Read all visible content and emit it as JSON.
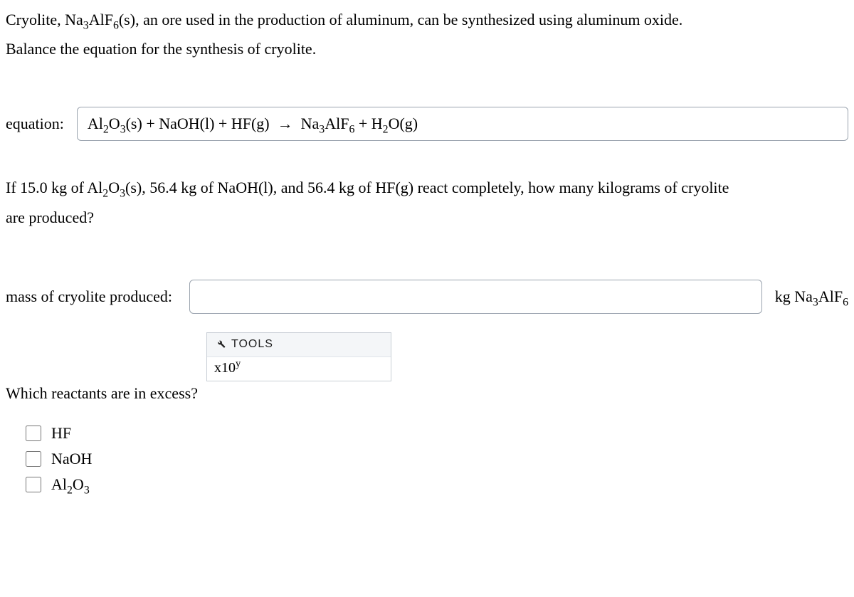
{
  "intro": {
    "line1_pre": "Cryolite, ",
    "line1_post": ", an ore used in the production of aluminum, can be synthesized using aluminum oxide.",
    "line2": "Balance the equation for the synthesis of cryolite."
  },
  "equation": {
    "label": "equation:",
    "value_html": "Al₂O₃(s) + NaOH(l) + HF(g) → Na₃AlF₆ + H₂O(g)"
  },
  "part2": {
    "q_pre": "If 15.0 kg of ",
    "q_mid1": ", 56.4 kg of NaOH(l), and 56.4 kg of HF(g) react completely, how many kilograms of cryolite",
    "q_line2": "are produced?"
  },
  "mass": {
    "label": "mass of cryolite produced:",
    "value": "",
    "unit_prefix": "kg "
  },
  "tools": {
    "header": "TOOLS",
    "sci_label": "x10"
  },
  "excess": {
    "question": "Which reactants are in excess?",
    "options": [
      {
        "label": "HF"
      },
      {
        "label": "NaOH"
      },
      {
        "label_html": "Al₂O₃"
      }
    ]
  }
}
